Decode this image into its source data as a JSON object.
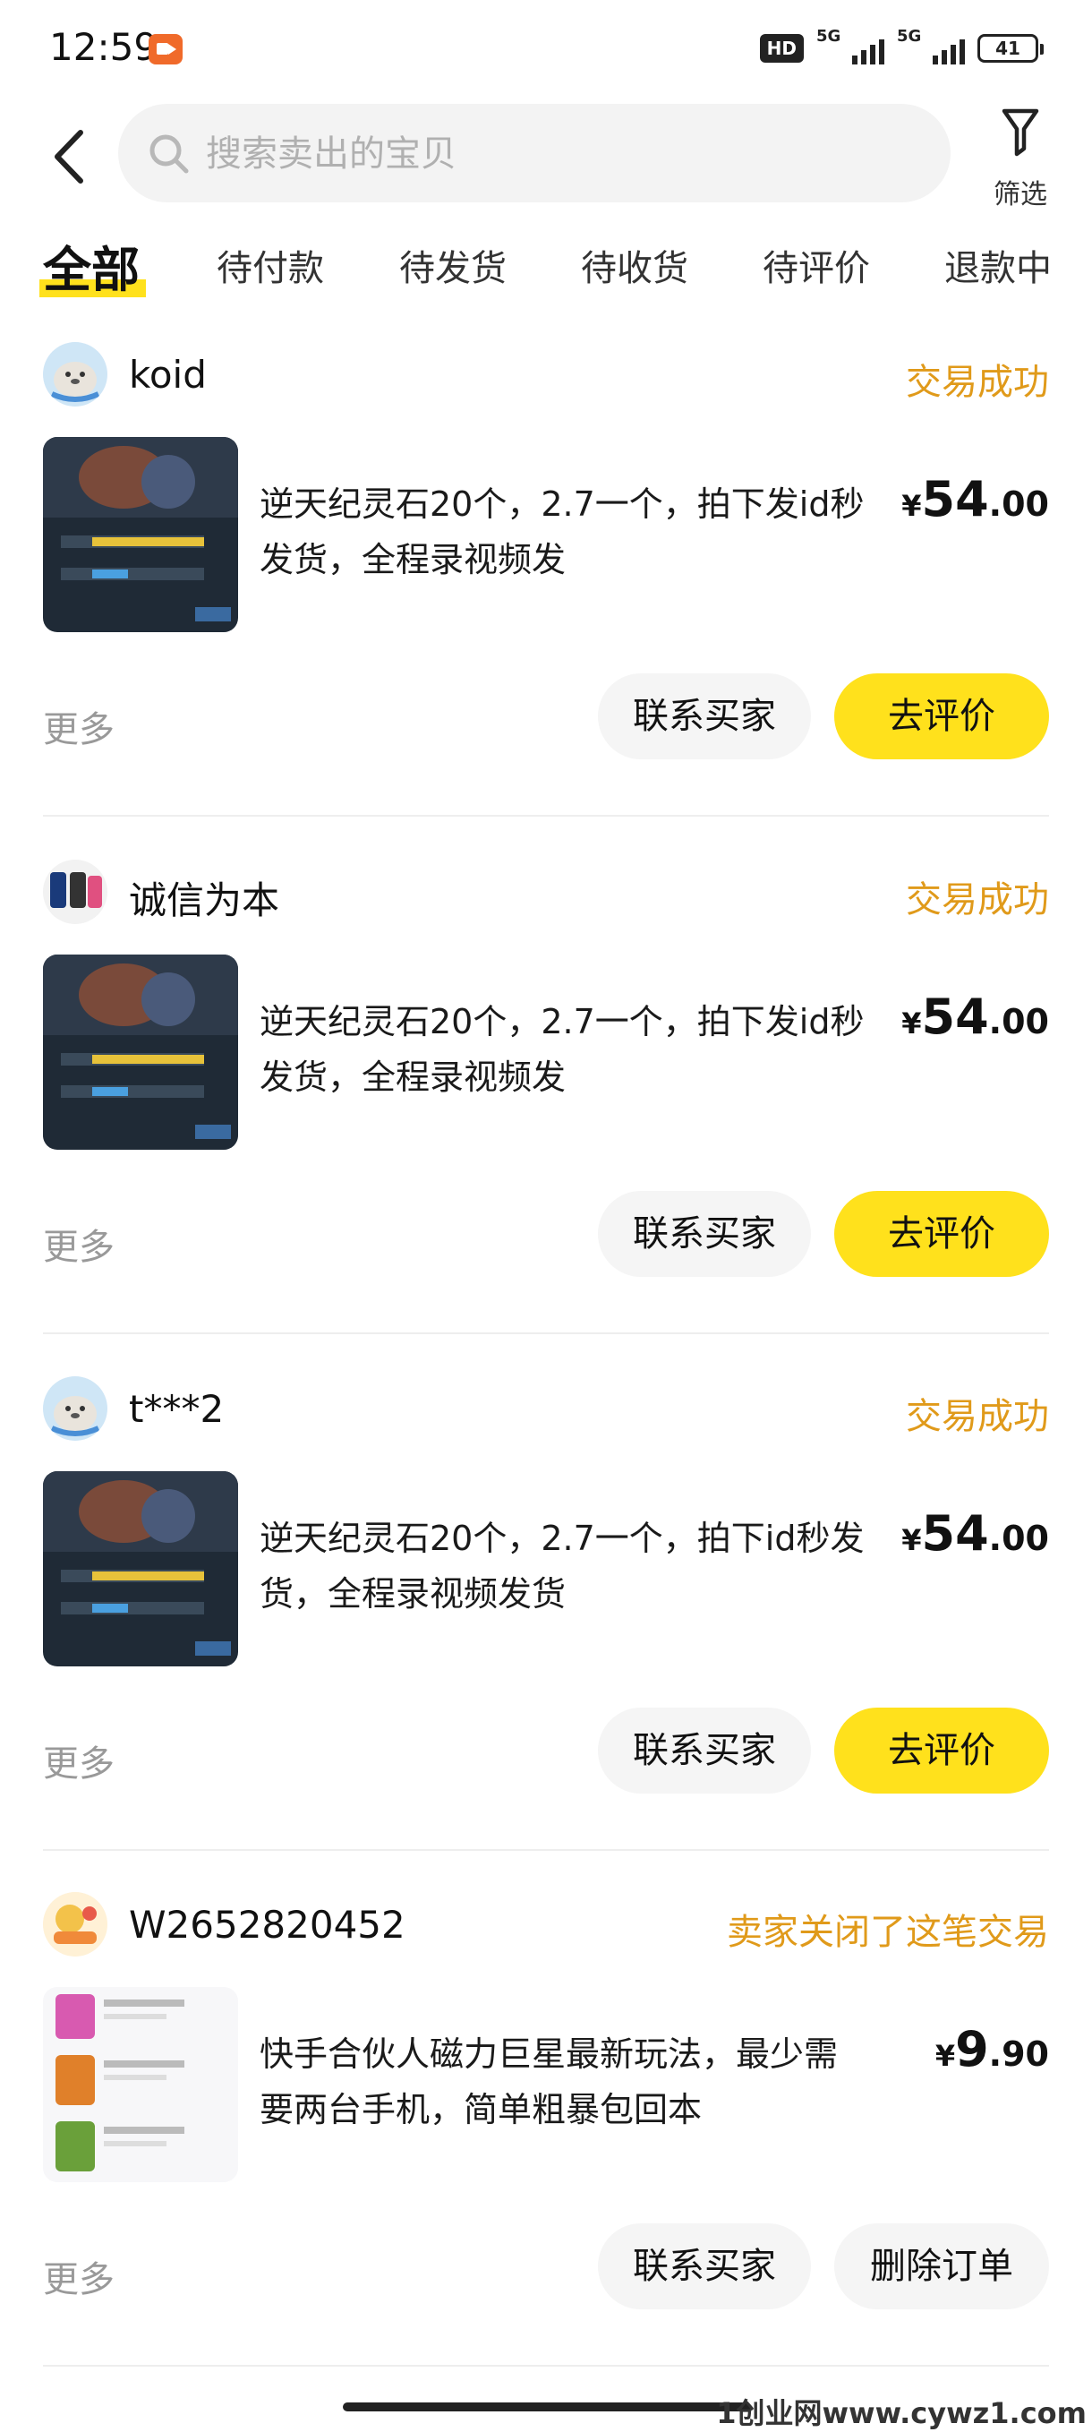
{
  "status_bar": {
    "time": "12:59",
    "hd_badge": "HD",
    "net1": "5G",
    "net2": "5G",
    "battery": "41"
  },
  "header": {
    "search_placeholder": "搜索卖出的宝贝",
    "filter_label": "筛选"
  },
  "tabs": [
    {
      "label": "全部",
      "active": true
    },
    {
      "label": "待付款"
    },
    {
      "label": "待发货"
    },
    {
      "label": "待收货"
    },
    {
      "label": "待评价"
    },
    {
      "label": "退款中"
    }
  ],
  "orders": [
    {
      "user": "koid",
      "status": "交易成功",
      "title": "逆天纪灵石20个，2.7一个，拍下发id秒发货，全程录视频发",
      "price_cur": "¥",
      "price_int": "54",
      "price_dec": ".00",
      "more": "更多",
      "btn_contact": "联系买家",
      "btn_action": "去评价"
    },
    {
      "user": "诚信为本",
      "status": "交易成功",
      "title": "逆天纪灵石20个，2.7一个，拍下发id秒发货，全程录视频发",
      "price_cur": "¥",
      "price_int": "54",
      "price_dec": ".00",
      "more": "更多",
      "btn_contact": "联系买家",
      "btn_action": "去评价"
    },
    {
      "user": "t***2",
      "status": "交易成功",
      "title": "逆天纪灵石20个，2.7一个，拍下id秒发货，全程录视频发货",
      "price_cur": "¥",
      "price_int": "54",
      "price_dec": ".00",
      "more": "更多",
      "btn_contact": "联系买家",
      "btn_action": "去评价"
    },
    {
      "user": "W2652820452",
      "status": "卖家关闭了这笔交易",
      "title": "快手合伙人磁力巨星最新玩法，最少需要两台手机，简单粗暴包回本",
      "price_cur": "¥",
      "price_int": "9",
      "price_dec": ".90",
      "more": "更多",
      "btn_contact": "联系买家",
      "btn_action": "删除订单"
    }
  ],
  "watermark": "1创业网www.cywz1.com",
  "colors": {
    "accent_yellow": "#ffe11c",
    "status_orange": "#e09a1a",
    "muted_gray": "#999999"
  }
}
